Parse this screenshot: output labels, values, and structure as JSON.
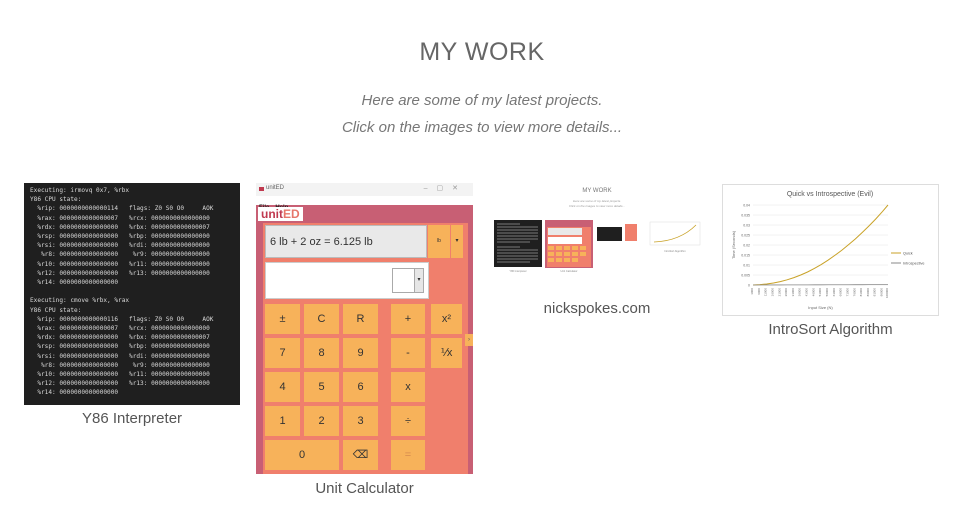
{
  "heading": "MY WORK",
  "subtitle_1": "Here are some of my latest projects.",
  "subtitle_2": "Click on the images to view more details...",
  "projects": [
    {
      "caption": "Y86 Interpreter",
      "terminal_text": "Executing: irmovq 0x7, %rbx\nY86 CPU state:\n  %rip: 0000000000000114   flags: Z0 S0 O0     AOK\n  %rax: 0000000000000007   %rcx: 0000000000000000\n  %rdx: 0000000000000000   %rbx: 0000000000000007\n  %rsp: 0000000000000000   %rbp: 0000000000000000\n  %rsi: 0000000000000000   %rdi: 0000000000000000\n   %r8: 0000000000000000    %r9: 0000000000000000\n  %r10: 0000000000000000   %r11: 0000000000000000\n  %r12: 0000000000000000   %r13: 0000000000000000\n  %r14: 0000000000000000\n\nExecuting: cmove %rbx, %rax\nY86 CPU state:\n  %rip: 0000000000000116   flags: Z0 S0 O0     AOK\n  %rax: 0000000000000007   %rcx: 0000000000000000\n  %rdx: 0000000000000000   %rbx: 0000000000000007\n  %rsp: 0000000000000000   %rbp: 0000000000000000\n  %rsi: 0000000000000000   %rdi: 0000000000000000\n   %r8: 0000000000000000    %r9: 0000000000000000\n  %r10: 0000000000000000   %r11: 0000000000000000\n  %r12: 0000000000000000   %r13: 0000000000000000\n  %r14: 0000000000000000"
    },
    {
      "caption": "Unit Calculator",
      "window_title": "unitED",
      "menu": [
        "File",
        "Help"
      ],
      "logo_a": "unit",
      "logo_b": "ED",
      "display": "6 lb + 2 oz = 6.125 lb",
      "unit_button": "lb",
      "keys": [
        "±",
        "C",
        "R",
        "+",
        "x²",
        "7",
        "8",
        "9",
        "-",
        "⅟x",
        "4",
        "5",
        "6",
        "x",
        "1",
        "2",
        "3",
        "÷",
        "0",
        "⌫",
        "="
      ]
    },
    {
      "caption": "nickspokes.com",
      "mini_heading": "MY WORK",
      "mini_sub_1": "Here are some of my latest projects.",
      "mini_sub_2": "Click on the images to view more details...",
      "mini_captions": [
        "Y86 Interpreter",
        "Unit Calculator",
        "IntroSort Algorithm"
      ]
    },
    {
      "caption": "IntroSort Algorithm",
      "chart_data": {
        "type": "line",
        "title": "Quick vs Introspective (Evil)",
        "xlabel": "Input Size (N)",
        "ylabel": "Time (Seconds)",
        "ylim": [
          0,
          0.04
        ],
        "yticks": [
          "0.04",
          "0.035",
          "0.03",
          "0.025",
          "0.02",
          "0.015",
          "0.01",
          "0.005",
          "0"
        ],
        "x": [
          1000,
          6000,
          11000,
          16000,
          21000,
          26000,
          31000,
          36000,
          41000,
          46000,
          51000,
          56000,
          61000,
          66000,
          71000,
          76000,
          81000,
          86000,
          91000,
          96000,
          100000
        ],
        "series": [
          {
            "name": "Quick",
            "color": "#c9a227",
            "values": [
              0,
              0.0002,
              0.0005,
              0.001,
              0.0017,
              0.0026,
              0.0037,
              0.005,
              0.0065,
              0.0083,
              0.0102,
              0.0124,
              0.0148,
              0.0173,
              0.0201,
              0.023,
              0.0262,
              0.0295,
              0.033,
              0.0368,
              0.04
            ]
          },
          {
            "name": "Introspective",
            "color": "#8a8a8a",
            "values": [
              0,
              1e-05,
              2e-05,
              3e-05,
              4e-05,
              5e-05,
              6e-05,
              7e-05,
              8e-05,
              9e-05,
              0.0001,
              0.00011,
              0.00012,
              0.00013,
              0.00014,
              0.00015,
              0.00016,
              0.00017,
              0.00018,
              0.00019,
              0.0002
            ]
          }
        ],
        "legend": "right",
        "grid": true
      }
    }
  ]
}
